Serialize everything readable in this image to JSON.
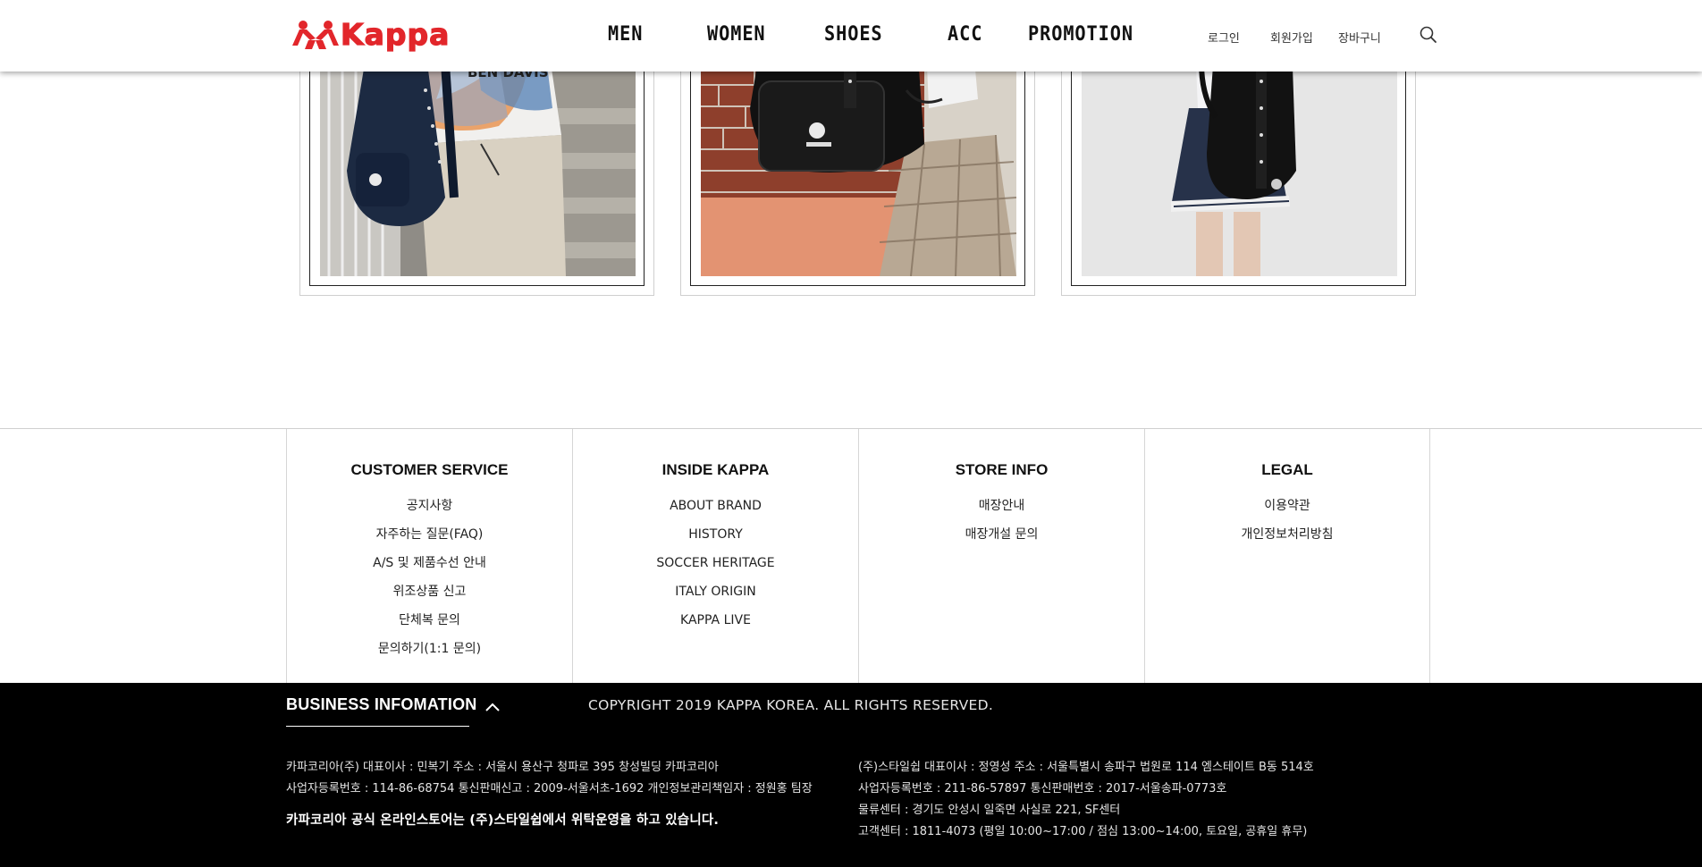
{
  "brand": {
    "logo_text": "Kappa",
    "accent": "#e2262b"
  },
  "nav": {
    "items": [
      {
        "label": "MEN"
      },
      {
        "label": "WOMEN"
      },
      {
        "label": "SHOES"
      },
      {
        "label": "ACC"
      },
      {
        "label": "PROMOTION"
      }
    ]
  },
  "util": {
    "login": "로그인",
    "join": "회원가입",
    "cart": "장바구니",
    "search_icon": "search-icon"
  },
  "products": [
    {
      "image": "person with navy kappa backpack on stairs"
    },
    {
      "image": "black kappa backpack against brick wall"
    },
    {
      "image": "person with black kappa backpack"
    }
  ],
  "footer": {
    "columns": [
      {
        "title": "CUSTOMER SERVICE",
        "links": [
          "공지사항",
          "자주하는 질문(FAQ)",
          "A/S 및 제품수선 안내",
          "위조상품 신고",
          "단체복 문의",
          "문의하기(1:1 문의)"
        ]
      },
      {
        "title": "INSIDE KAPPA",
        "links": [
          "ABOUT BRAND",
          "HISTORY",
          "SOCCER HERITAGE",
          "ITALY ORIGIN",
          "KAPPA LIVE"
        ]
      },
      {
        "title": "STORE INFO",
        "links": [
          "매장안내",
          "매장개설 문의"
        ]
      },
      {
        "title": "LEGAL",
        "links": [
          "이용약관",
          "개인정보처리방침"
        ]
      }
    ]
  },
  "business": {
    "title": "BUSINESS INFOMATION",
    "copyright": "COPYRIGHT 2019 KAPPA KOREA. ALL RIGHTS RESERVED.",
    "left_lines": [
      "카파코리아(주) 대표이사 : 민복기 주소 : 서울시 용산구 청파로 395 창성빌딩 카파코리아",
      "사업자등록번호 : 114-86-68754 통신판매신고 : 2009-서울서초-1692 개인정보관리책임자 : 정원홍 팀장"
    ],
    "notice": "카파코리아 공식 온라인스토어는 (주)스타일쉽에서 위탁운영을 하고 있습니다.",
    "right_lines": [
      "(주)스타일쉽 대표이사 : 정영성 주소 : 서울특별시 송파구 법원로 114 엠스테이트 B동 514호",
      "사업자등록번호 : 211-86-57897 통신판매번호 : 2017-서울송파-0773호",
      "물류센터 : 경기도 안성시 일죽면 사실로 221, SF센터",
      "고객센터 : 1811-4073 (평일 10:00~17:00 / 점심 13:00~14:00, 토요일, 공휴일 휴무)"
    ]
  }
}
